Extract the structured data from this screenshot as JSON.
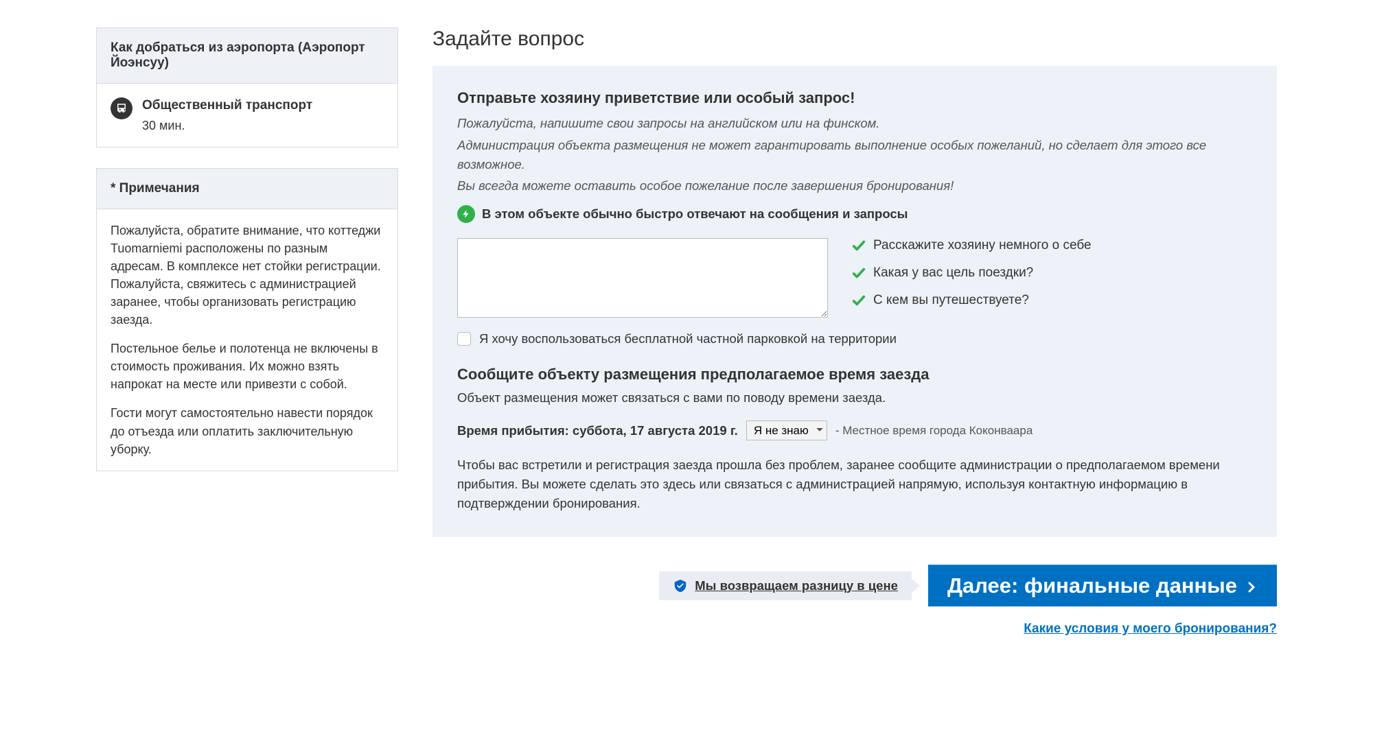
{
  "sidebar": {
    "airport_card": {
      "title": "Как добраться из аэропорта (Аэропорт Йоэнсуу)",
      "transport_label": "Общественный транспорт",
      "transport_time": "30 мин."
    },
    "notes_card": {
      "title": "* Примечания",
      "p1": "Пожалуйста, обратите внимание, что коттеджи Tuomarniemi расположены по разным адресам. В комплексе нет стойки регистрации. Пожалуйста, свяжитесь с администрацией заранее, чтобы организовать регистрацию заезда.",
      "p2": "Постельное белье и полотенца не включены в стоимость проживания. Их можно взять напрокат на месте или привезти с собой.",
      "p3": "Гости могут самостоятельно навести порядок до отъезда или оплатить заключительную уборку."
    }
  },
  "main": {
    "title": "Задайте вопрос",
    "panel": {
      "greeting_heading": "Отправьте хозяину приветствие или особый запрос!",
      "subnote1": "Пожалуйста, напишите свои запросы на английском или на финском.",
      "subnote2": "Администрация объекта размещения не может гарантировать выполнение особых пожеланий, но сделает для этого все возможное.",
      "subnote3": "Вы всегда можете оставить особое пожелание после завершения бронирования!",
      "fast_reply": "В этом объекте обычно быстро отвечают на сообщения и запросы",
      "hints": [
        "Расскажите хозяину немного о себе",
        "Какая у вас цель поездки?",
        "С кем вы путешествуете?"
      ],
      "parking_checkbox": "Я хочу воспользоваться бесплатной частной парковкой на территории",
      "arrival_heading": "Сообщите объекту размещения предполагаемое время заезда",
      "arrival_sub": "Объект размещения может связаться с вами по поводу времени заезда.",
      "arrival_label": "Время прибытия: суббота, 17 августа 2019 г.",
      "arrival_select": "Я не знаю",
      "tz_note": "- Местное время города Коконваара",
      "arrival_info": "Чтобы вас встретили и регистрация заезда прошла без проблем, заранее сообщите администрации о предполагаемом времени прибытия. Вы можете сделать это здесь или связаться с администрацией напрямую, используя контактную информацию в подтверждении бронирования."
    },
    "price_match": "Мы возвращаем разницу в цене",
    "next_button": "Далее: финальные данные",
    "terms_link": "Какие условия у моего бронирования?"
  }
}
